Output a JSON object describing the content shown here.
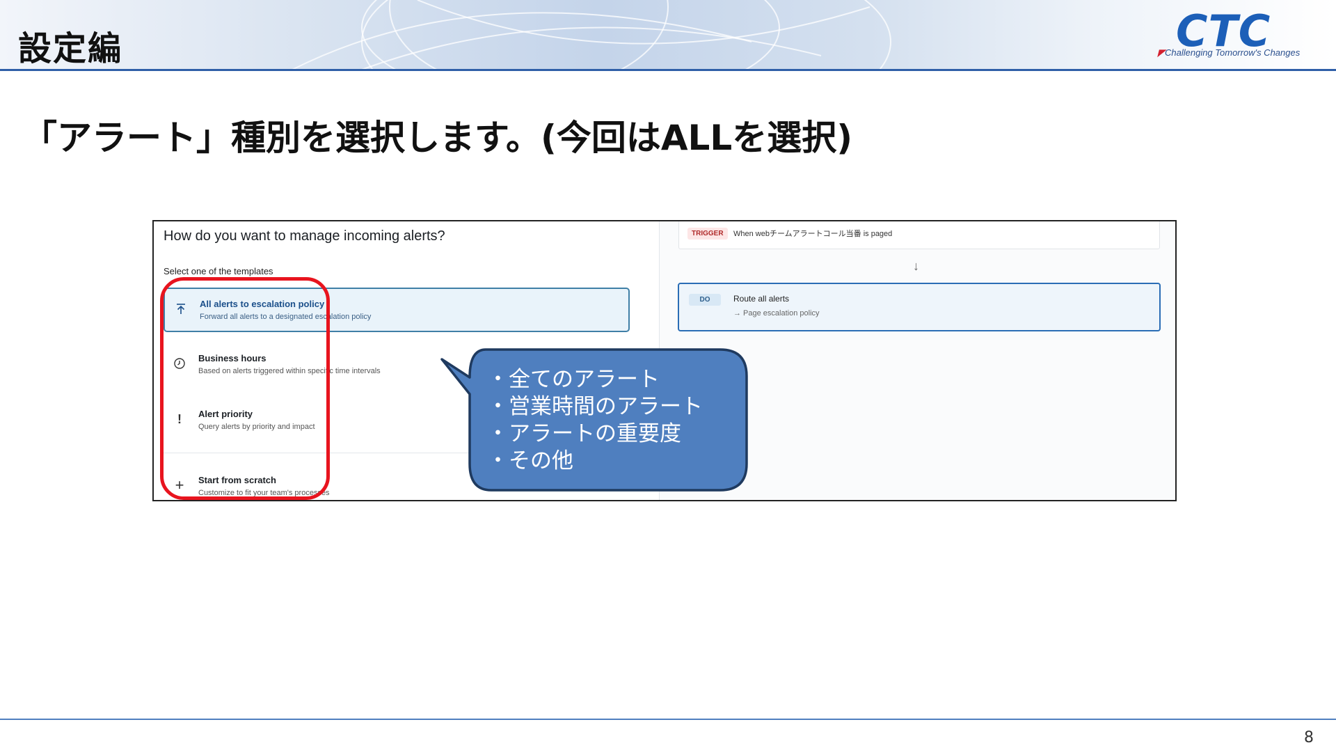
{
  "header": {
    "section_title": "設定編",
    "logo_text": "CTC",
    "tagline": "Challenging Tomorrow's Changes"
  },
  "main_heading": "「アラート」種別を選択します。(今回はALLを選択)",
  "screenshot": {
    "question": "How do you want to manage incoming alerts?",
    "subtitle": "Select one of the templates",
    "templates": [
      {
        "title": "All alerts to escalation policy",
        "desc": "Forward all alerts to a designated escalation policy",
        "icon": "arrow-up-bar-icon"
      },
      {
        "title": "Business hours",
        "desc": "Based on alerts triggered within specific time intervals",
        "icon": "clock-icon"
      },
      {
        "title": "Alert priority",
        "desc": "Query alerts by priority and impact",
        "icon": "exclamation-icon"
      },
      {
        "title": "Start from scratch",
        "desc": "Customize to fit your team's processes",
        "icon": "plus-icon"
      }
    ],
    "trigger": {
      "tag": "TRIGGER",
      "text": "When  webチームアラートコール当番  is paged"
    },
    "action": {
      "tag": "DO",
      "title": "Route all alerts",
      "sub": "→ Page escalation policy"
    }
  },
  "callout": {
    "lines": [
      "・全てのアラート",
      "・営業時間のアラート",
      "・アラートの重要度",
      "・その他"
    ]
  },
  "page_number": "8",
  "colors": {
    "accent_blue": "#2f5fa8",
    "callout_fill": "#4f7fbf",
    "callout_border": "#1f3a5f",
    "highlight_red": "#e8141e"
  }
}
